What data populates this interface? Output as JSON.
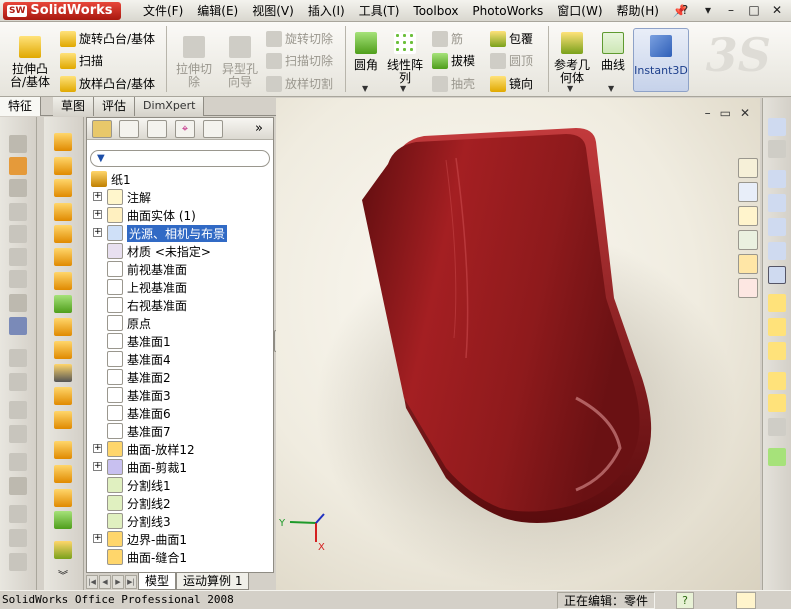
{
  "window": {
    "app_name": "SolidWorks",
    "app_badge": "SW",
    "controls": [
      "?",
      "▾",
      "–",
      "□",
      "✕"
    ]
  },
  "menu": {
    "items": [
      "文件(F)",
      "编辑(E)",
      "视图(V)",
      "插入(I)",
      "工具(T)",
      "Toolbox",
      "PhotoWorks",
      "窗口(W)",
      "帮助(H)"
    ]
  },
  "ribbon": {
    "extrude_boss": "拉伸凸台/基体",
    "revolve_boss": "旋转凸台/基体",
    "sweep": "扫描",
    "loft_boss": "放样凸台/基体",
    "extrude_cut": "拉伸切除",
    "hole_wizard": "异型孔向导",
    "revolve_cut": "旋转切除",
    "sweep_cut": "扫描切除",
    "loft_cut": "放样切割",
    "fillet": "圆角",
    "linear_pattern": "线性阵列",
    "rib": "筋",
    "draft": "拔模",
    "shell": "抽壳",
    "wrap": "包覆",
    "dome": "圆顶",
    "mirror": "镜向",
    "ref_geometry": "参考几何体",
    "curves": "曲线",
    "instant3d": "Instant3D",
    "brand_mark": "3S"
  },
  "tabs": {
    "features": "特征",
    "sketch": "草图",
    "evaluate": "评估",
    "dimxpert": "DimXpert"
  },
  "feature_tree": {
    "more": "»",
    "part_name": "纸1",
    "items": [
      {
        "label": "注解",
        "expandable": true
      },
      {
        "label": "曲面实体 (1)",
        "expandable": true
      },
      {
        "label": "光源、相机与布景",
        "expandable": true,
        "selected": true
      },
      {
        "label": "材质 <未指定>",
        "expandable": false
      },
      {
        "label": "前视基准面",
        "expandable": false
      },
      {
        "label": "上视基准面",
        "expandable": false
      },
      {
        "label": "右视基准面",
        "expandable": false
      },
      {
        "label": "原点",
        "expandable": false
      },
      {
        "label": "基准面1",
        "expandable": false
      },
      {
        "label": "基准面4",
        "expandable": false
      },
      {
        "label": "基准面2",
        "expandable": false
      },
      {
        "label": "基准面3",
        "expandable": false
      },
      {
        "label": "基准面6",
        "expandable": false
      },
      {
        "label": "基准面7",
        "expandable": false
      },
      {
        "label": "曲面-放样12",
        "expandable": true
      },
      {
        "label": "曲面-剪裁1",
        "expandable": true
      },
      {
        "label": "分割线1",
        "expandable": false
      },
      {
        "label": "分割线2",
        "expandable": false
      },
      {
        "label": "分割线3",
        "expandable": false
      },
      {
        "label": "边界-曲面1",
        "expandable": true
      },
      {
        "label": "曲面-缝合1",
        "expandable": false
      }
    ]
  },
  "bottom_tabs": {
    "model": "模型",
    "motion_study": "运动算例 1"
  },
  "viewport": {
    "triad_x": "X",
    "triad_y": "Y",
    "model_color": "#8e1a1c"
  },
  "status": {
    "product": "SolidWorks Office Professional 2008",
    "editing": "正在编辑：零件",
    "help": "?"
  }
}
